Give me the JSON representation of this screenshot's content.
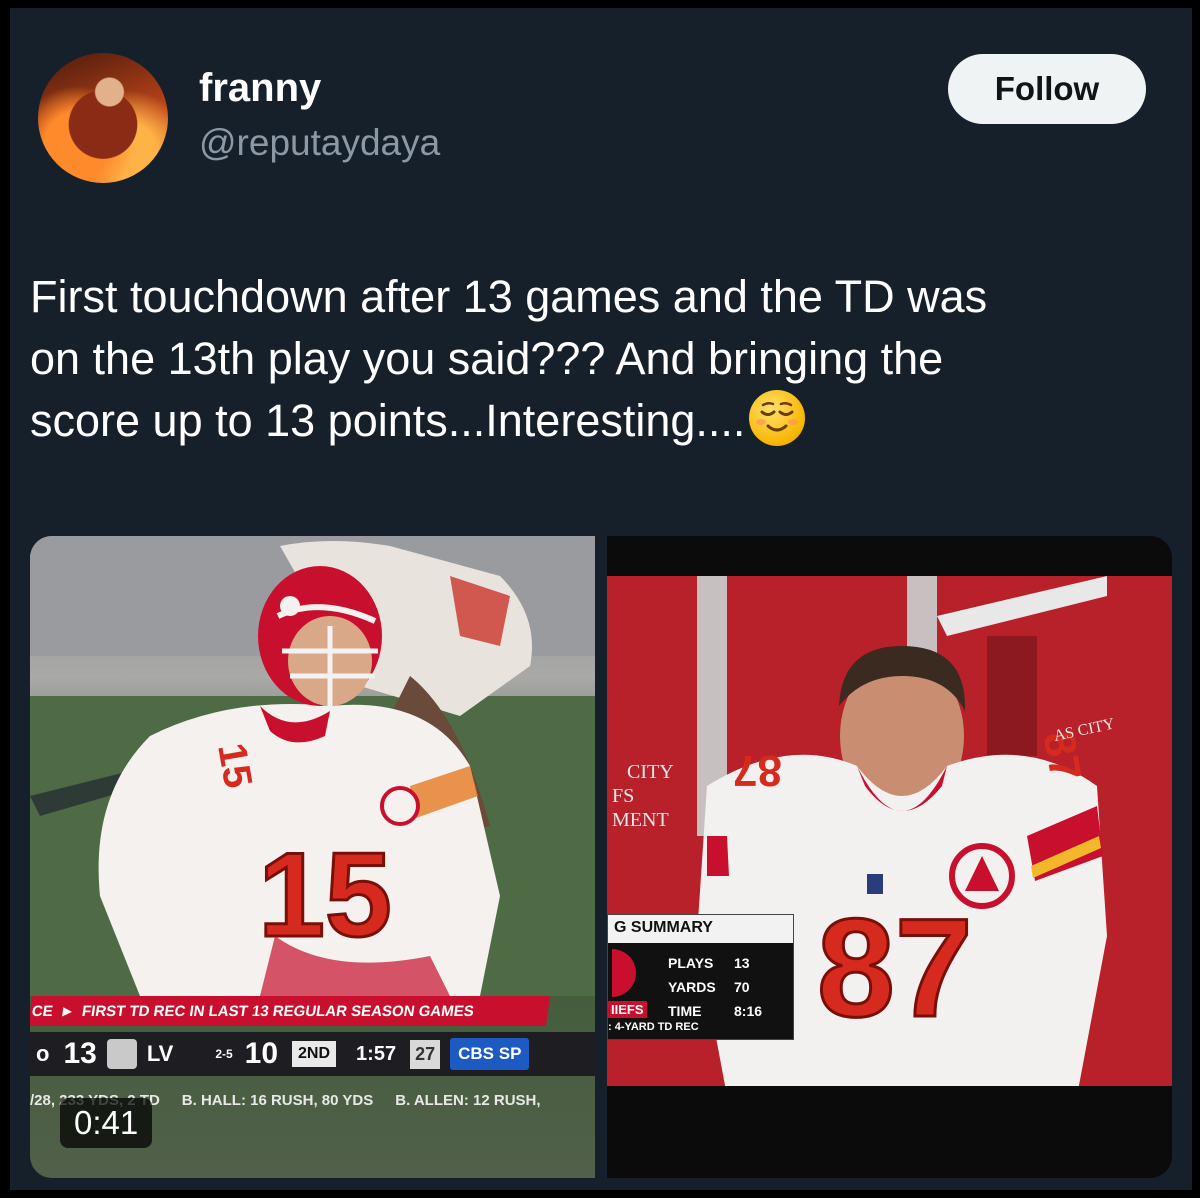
{
  "tweet": {
    "author_name": "franny",
    "handle": "@reputaydaya",
    "follow_label": "Follow",
    "text_line1": "First touchdown after 13 games and the TD was",
    "text_line2": "on the 13th play you said??? And bringing the",
    "text_line3": "score up to 13 points...Interesting....",
    "emoji": "relieved-face-emoji"
  },
  "media_left": {
    "jersey_number": "15",
    "chyron_prefix": "CE",
    "chyron_text": "FIRST TD REC IN LAST 13 REGULAR SEASON GAMES",
    "score_prefix": "o",
    "team1_score": "13",
    "team2_abbr": "LV",
    "team2_record": "2-5",
    "team2_score": "10",
    "quarter": "2ND",
    "clock": "1:57",
    "play_clock": "27",
    "network": "CBS SP",
    "ticker_1": "/28, 233 YDS, 2 TD",
    "ticker_2": "B. HALL: 16 RUSH, 80 YDS",
    "ticker_3": "B. ALLEN: 12 RUSH,",
    "duration": "0:41"
  },
  "media_right": {
    "jersey_number": "87",
    "wall_text_1": "CITY",
    "wall_text_2": "FS",
    "wall_text_3": "MENT",
    "wall_text_right": "AS CITY",
    "summary_title": "G SUMMARY",
    "summary_rows": [
      {
        "label": "PLAYS",
        "value": "13"
      },
      {
        "label": "YARDS",
        "value": "70"
      },
      {
        "label": "TIME",
        "value": "8:16"
      }
    ],
    "summary_team": "IIEFS",
    "summary_footer": ": 4-YARD TD REC"
  },
  "colors": {
    "background": "#15202b",
    "text": "#ffffff",
    "secondary_text": "#8b98a5",
    "follow_bg": "#eff3f4",
    "chiefs_red": "#c8102e"
  }
}
